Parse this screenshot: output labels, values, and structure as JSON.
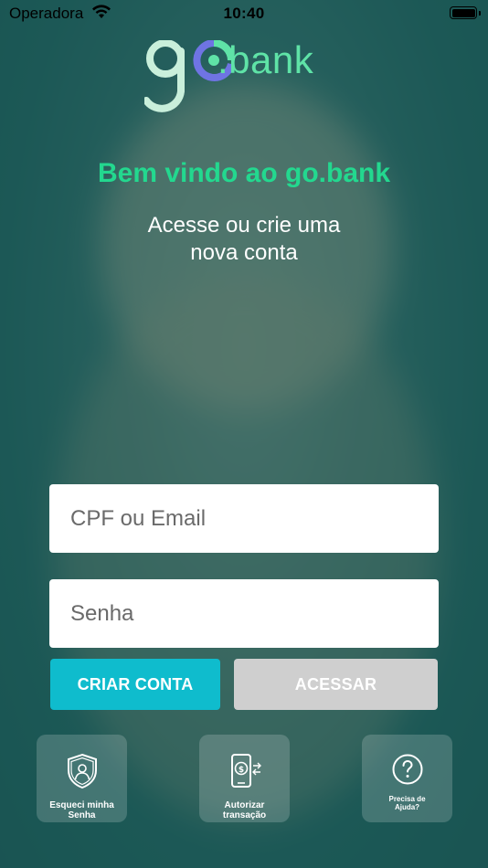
{
  "status_bar": {
    "carrier": "Operadora",
    "time": "10:40"
  },
  "brand": {
    "logo_text": ".bank",
    "accent": "#23d88f",
    "logo_color": "#5fe3a7"
  },
  "header": {
    "welcome": "Bem vindo ao go.bank",
    "subtitle": "Acesse ou crie uma\nnova conta"
  },
  "form": {
    "login_placeholder": "CPF ou Email",
    "password_placeholder": "Senha"
  },
  "buttons": {
    "create_account": "CRIAR CONTA",
    "sign_in": "ACESSAR"
  },
  "shortcuts": [
    {
      "label": "Esqueci minha\nSenha",
      "icon": "shield-user-icon"
    },
    {
      "label": "Autorizar\ntransação",
      "icon": "phone-money-icon"
    },
    {
      "label": "Precisa de\nAjuda?",
      "icon": "help-icon"
    }
  ]
}
